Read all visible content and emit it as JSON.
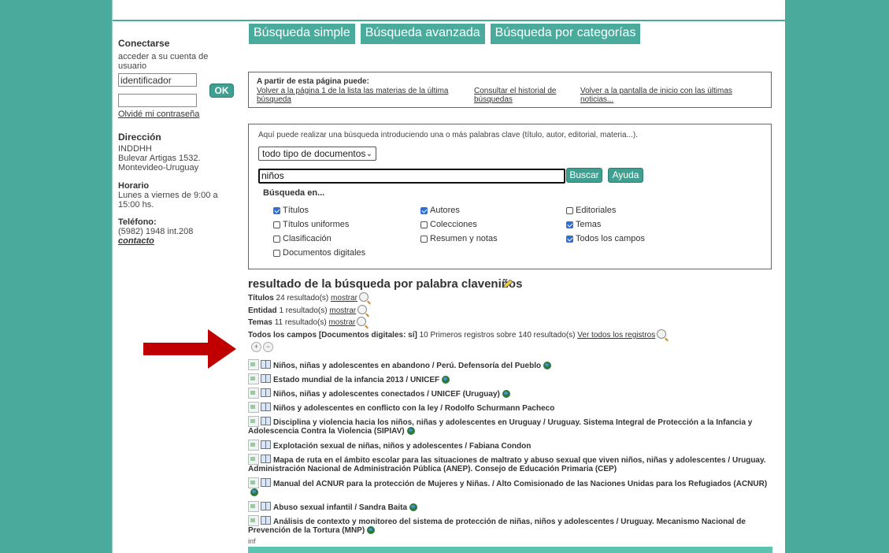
{
  "sidebar": {
    "login_heading": "Conectarse",
    "login_sub": "acceder a su cuenta de usuario",
    "user_placeholder": "identificador",
    "password_value": "",
    "ok_label": "OK",
    "forgot_label": "Olvidé mi contraseña",
    "address_heading": "Dirección",
    "address_lines": [
      "INDDHH",
      "Bulevar Artigas 1532.",
      "Montevideo-Uruguay"
    ],
    "hours_heading": "Horario",
    "hours_lines": [
      "Lunes a viernes de 9:00 a",
      "15:00 hs."
    ],
    "phone_heading": "Teléfono:",
    "phone_value": "(5982) 1948 int.208",
    "contact_label": "contacto"
  },
  "tabs": [
    "Búsqueda simple",
    "Búsqueda avanzada",
    "Búsqueda por categorías"
  ],
  "info": {
    "heading": "A partir de esta página puede:",
    "links": [
      [
        "Volver a la página 1 de la lista las materias de la última",
        "búsqueda"
      ],
      [
        "Consultar el historial de",
        "búsquedas"
      ],
      [
        "Volver a la pantalla de inicio con las últimas",
        "noticias..."
      ]
    ]
  },
  "search": {
    "intro": "Aquí puede realizar una búsqueda introduciendo una o más palabras clave (título, autor, editorial, materia...).",
    "doc_type": "todo tipo de documentos",
    "query": "niños",
    "buscar_label": "Buscar",
    "ayuda_label": "Ayuda",
    "busqueda_en": "Búsqueda en...",
    "checkboxes": [
      {
        "label": "Títulos",
        "checked": true
      },
      {
        "label": "Autores",
        "checked": true
      },
      {
        "label": "Editoriales",
        "checked": false
      },
      {
        "label": "Títulos uniformes",
        "checked": false
      },
      {
        "label": "Colecciones",
        "checked": false
      },
      {
        "label": "Temas",
        "checked": true
      },
      {
        "label": "Clasificación",
        "checked": false
      },
      {
        "label": "Resumen y notas",
        "checked": false
      },
      {
        "label": "Todos los campos",
        "checked": true
      },
      {
        "label": "Documentos digitales",
        "checked": false
      }
    ]
  },
  "results": {
    "title": "resultado de la búsqueda por palabra claveniños",
    "summary": [
      {
        "label": "Títulos",
        "text": " 24 resultado(s) ",
        "link": "mostrar"
      },
      {
        "label": "Entidad",
        "text": " 1 resultado(s) ",
        "link": "mostrar"
      },
      {
        "label": "Temas",
        "text": " 11 resultado(s) ",
        "link": "mostrar"
      },
      {
        "label": "Todos los campos [Documentos digitales: sí]",
        "text": " 10 Primeros registros sobre 140 resultado(s) ",
        "link": "Ver todos los registros"
      }
    ],
    "items": [
      "Niños, niñas y adolescentes en abandono / Perú. Defensoría del Pueblo",
      "Estado mundial de la infancia 2013 / UNICEF",
      "Niños, niñas y adolescentes conectados / UNICEF (Uruguay)",
      "Niños y adolescentes en conflicto con la ley / Rodolfo Schurmann Pacheco",
      "Disciplina y violencia hacia los niños, niñas y adolescentes en Uruguay / Uruguay. Sistema Integral de Protección a la Infancia y Adolescencia Contra la Violencia (SIPIAV)",
      "Explotación sexual de niñas, niños y adolescentes / Fabiana Condon",
      "Mapa de ruta en el ámbito escolar para las situaciones de maltrato y abuso sexual que viven niños, niñas y adolescentes / Uruguay. Administración Nacional de Administración Pública (ANEP). Consejo de Educación Primaria (CEP)",
      "Manual del ACNUR para la protección de Mujeres y Niñas. / Alto Comisionado de las Naciones Unidas para los Refugiados (ACNUR)",
      "Abuso sexual infantil / Sandra Baita",
      "Análisis de contexto y monitoreo del sistema de protección de niñas, niños y adolescentes / Uruguay. Mecanismo Nacional de Prevención de la Tortura (MNP)"
    ],
    "broken_img_text": "inf"
  },
  "colors": {
    "accent": "#4aab9d",
    "arrow": "#c00000"
  }
}
